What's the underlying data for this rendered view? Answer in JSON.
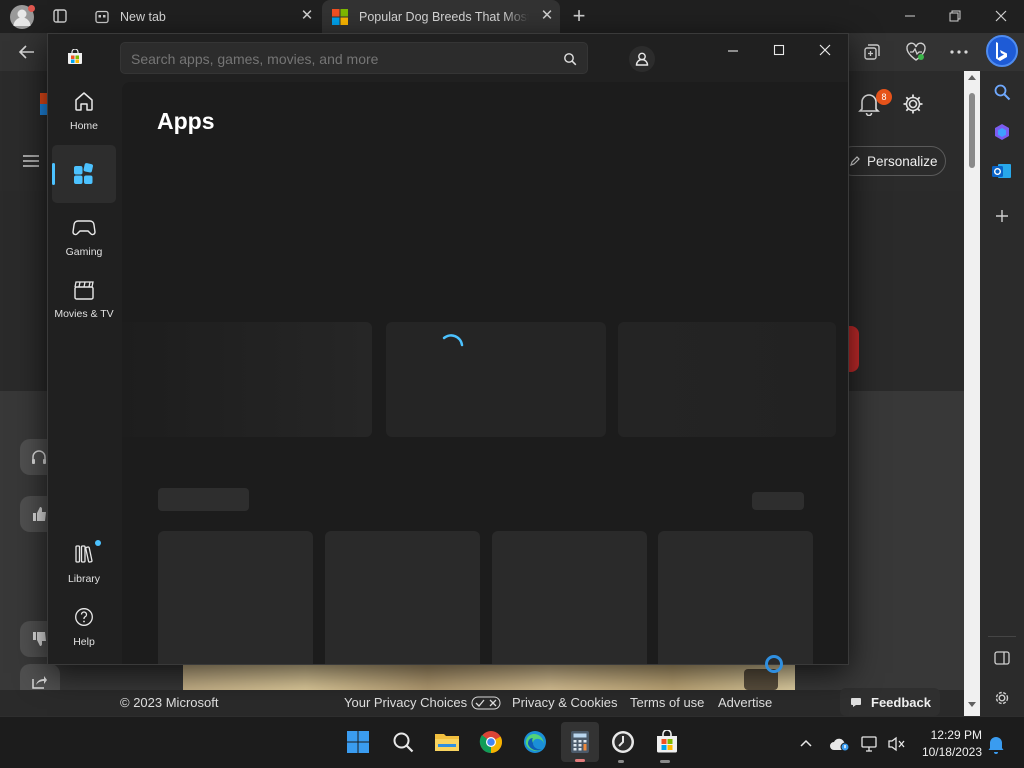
{
  "browser": {
    "tabs": [
      {
        "title": "New tab"
      },
      {
        "title": "Popular Dog Breeds That Most P"
      }
    ],
    "new_tab_symbol": "+"
  },
  "webpage": {
    "personalize_label": "Personalize",
    "notification_count": "8",
    "footer": {
      "copyright": "© 2023 Microsoft",
      "links": [
        "Your Privacy Choices",
        "Privacy & Cookies",
        "Terms of use",
        "Advertise"
      ],
      "feedback": "Feedback"
    }
  },
  "store": {
    "search_placeholder": "Search apps, games, movies, and more",
    "page_title": "Apps",
    "nav": {
      "home": "Home",
      "gaming": "Gaming",
      "movies": "Movies & TV",
      "library": "Library",
      "help": "Help"
    },
    "accent_color": "#4cc2ff"
  },
  "taskbar": {
    "time": "12:29 PM",
    "date": "10/18/2023",
    "apps": [
      "start-icon",
      "search-icon",
      "file-explorer-icon",
      "chrome-icon",
      "edge-icon",
      "calculator-icon",
      "clock-icon",
      "store-icon"
    ]
  }
}
